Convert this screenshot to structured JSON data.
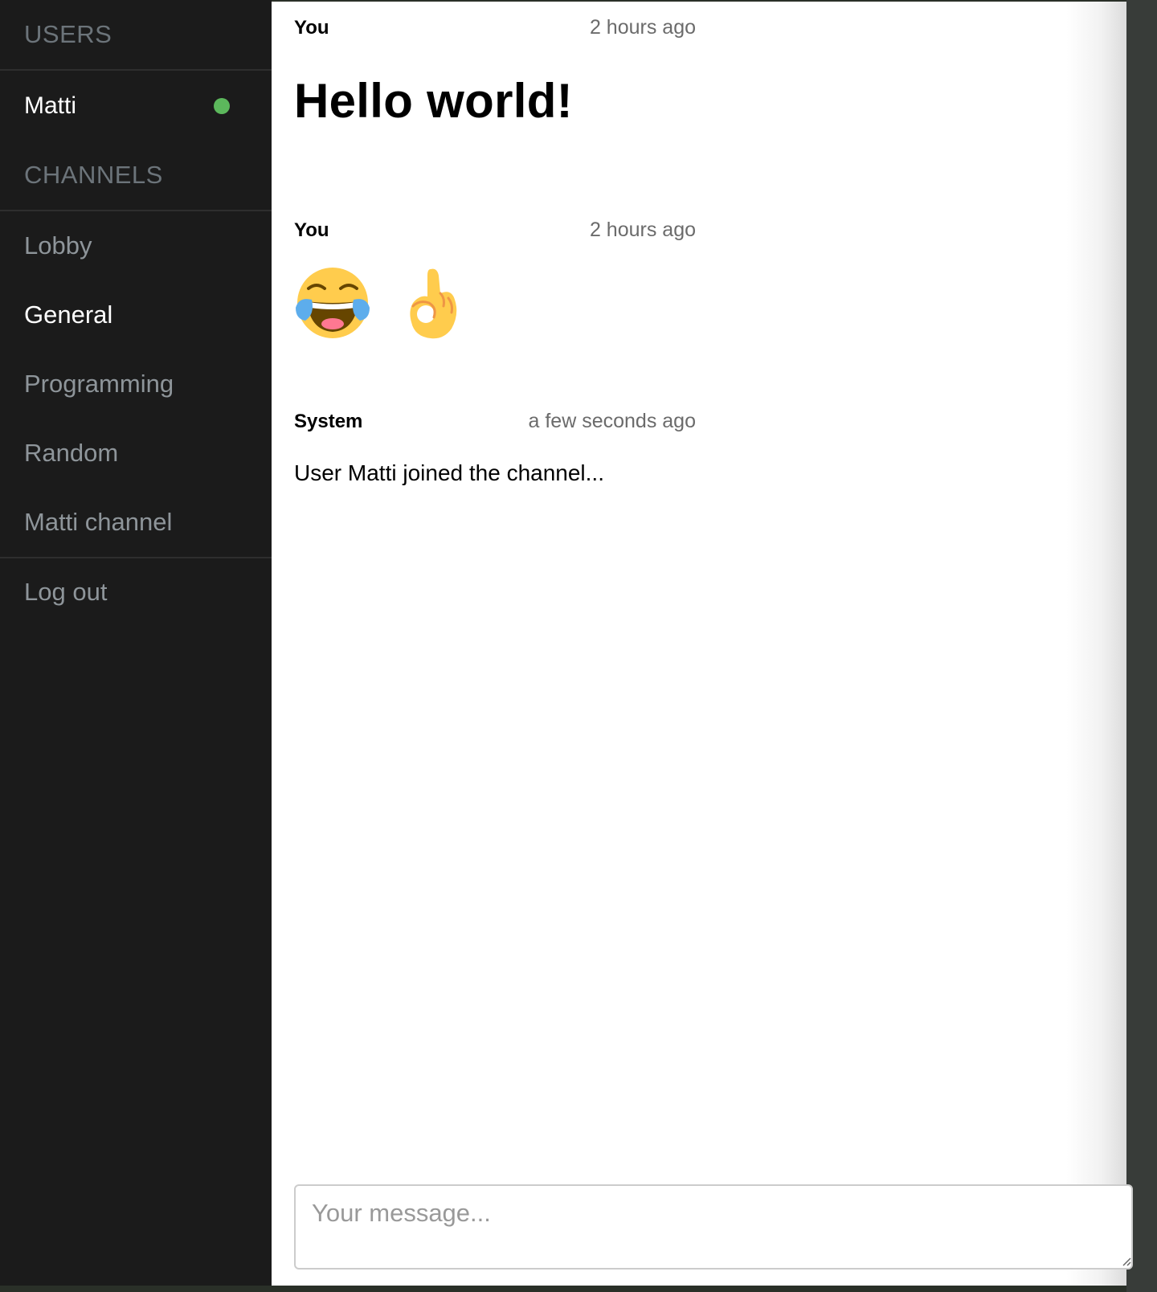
{
  "sidebar": {
    "users_heading": "USERS",
    "users": [
      {
        "name": "Matti",
        "status": "online",
        "status_color": "#5cb85c"
      }
    ],
    "channels_heading": "CHANNELS",
    "channels": [
      {
        "label": "Lobby",
        "active": false
      },
      {
        "label": "General",
        "active": true
      },
      {
        "label": "Programming",
        "active": false
      },
      {
        "label": "Random",
        "active": false
      },
      {
        "label": "Matti channel",
        "active": false
      }
    ],
    "logout_label": "Log out"
  },
  "messages": [
    {
      "author": "You",
      "time": "2 hours ago",
      "heading": "Hello world!"
    },
    {
      "author": "You",
      "time": "2 hours ago",
      "emojis": [
        "face-with-tears-of-joy-icon",
        "ok-hand-icon"
      ]
    },
    {
      "author": "System",
      "time": "a few seconds ago",
      "text": "User Matti joined the channel..."
    }
  ],
  "composer": {
    "placeholder": "Your message...",
    "value": ""
  },
  "colors": {
    "sidebar_bg": "#1b1b1b",
    "active_text": "#ffffff",
    "inactive_text": "#8e959a",
    "heading_text": "#6c747a",
    "online": "#5cb85c"
  }
}
